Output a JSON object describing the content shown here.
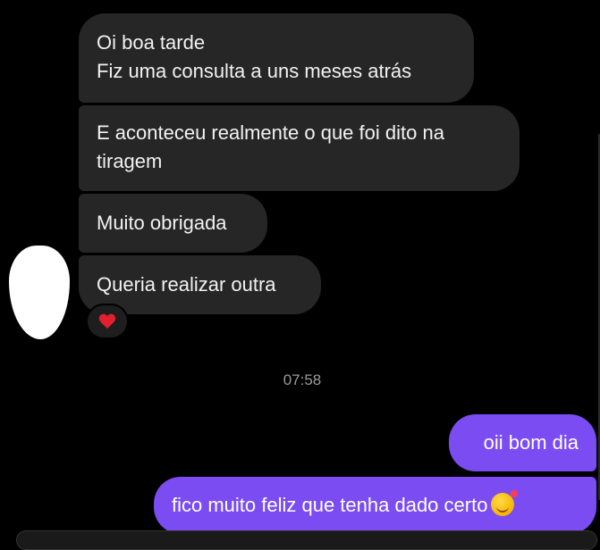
{
  "messages": {
    "incoming": [
      {
        "lines": [
          "Oi boa tarde",
          "Fiz uma consulta a uns meses atrás"
        ]
      },
      {
        "lines": [
          "E aconteceu realmente o que foi dito na",
          "tiragem"
        ]
      },
      {
        "lines": [
          "Muito obrigada"
        ]
      },
      {
        "lines": [
          "Queria realizar outra"
        ]
      }
    ],
    "reaction": {
      "icon": "red-heart-icon"
    },
    "timestamp": "07:58",
    "outgoing": [
      {
        "text": "oii bom dia"
      },
      {
        "text": "fico muito feliz que tenha dado certo",
        "emoji": "smiling-face-with-hearts-icon"
      }
    ]
  },
  "colors": {
    "background": "#000000",
    "incoming_bubble": "#262626",
    "outgoing_bubble": "#7a4cf2",
    "timestamp": "#9a9a9a"
  }
}
